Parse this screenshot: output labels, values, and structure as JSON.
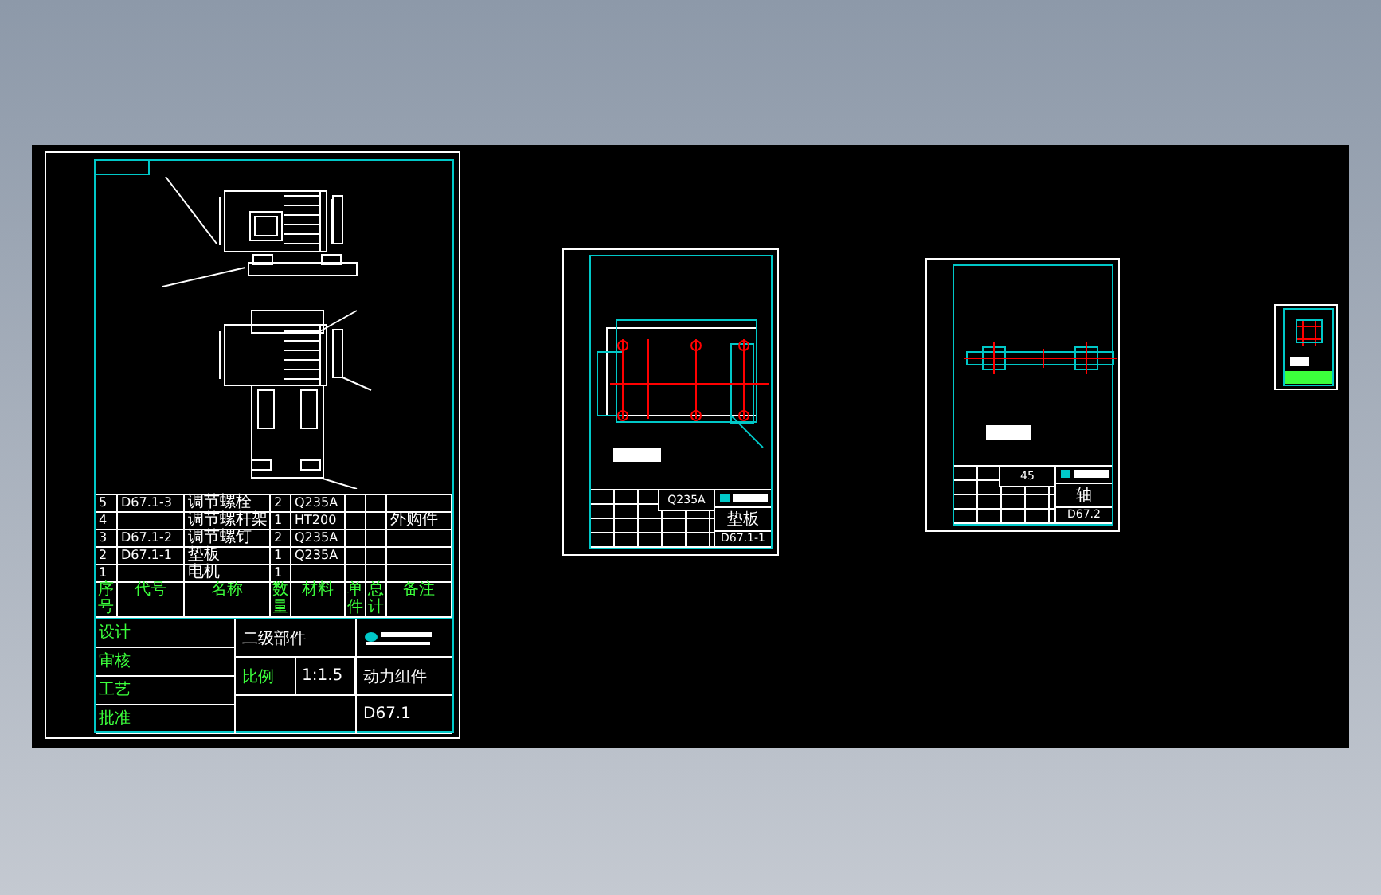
{
  "assembly_sheet": {
    "bom_header": [
      "序号",
      "代号",
      "名称",
      "数量",
      "材料",
      "单件",
      "总计",
      "备注"
    ],
    "bom_rows": [
      {
        "no": "5",
        "code": "D67.1-3",
        "name": "调节螺栓",
        "qty": "2",
        "material": "Q235A",
        "remark": ""
      },
      {
        "no": "4",
        "code": "",
        "name": "调节螺杆架",
        "qty": "1",
        "material": "HT200",
        "remark": "外购件"
      },
      {
        "no": "3",
        "code": "D67.1-2",
        "name": "调节螺钉",
        "qty": "2",
        "material": "Q235A",
        "remark": ""
      },
      {
        "no": "2",
        "code": "D67.1-1",
        "name": "垫板",
        "qty": "1",
        "material": "Q235A",
        "remark": ""
      },
      {
        "no": "1",
        "code": "",
        "name": "电机",
        "qty": "1",
        "material": "",
        "remark": ""
      }
    ],
    "signoff_labels": [
      "设计",
      "审核",
      "工艺",
      "批准"
    ],
    "level": "二级部件",
    "scale_label": "比例",
    "scale": "1:1.5",
    "title": "动力组件",
    "code": "D67.1"
  },
  "part_sheets": [
    {
      "kind": "plate",
      "material": "Q235A",
      "title": "垫板",
      "code": "D67.1-1"
    },
    {
      "kind": "shaft",
      "material": "45",
      "title": "轴",
      "code": "D67.2"
    }
  ],
  "thumbnail_sheet": {
    "kind": "plate"
  }
}
